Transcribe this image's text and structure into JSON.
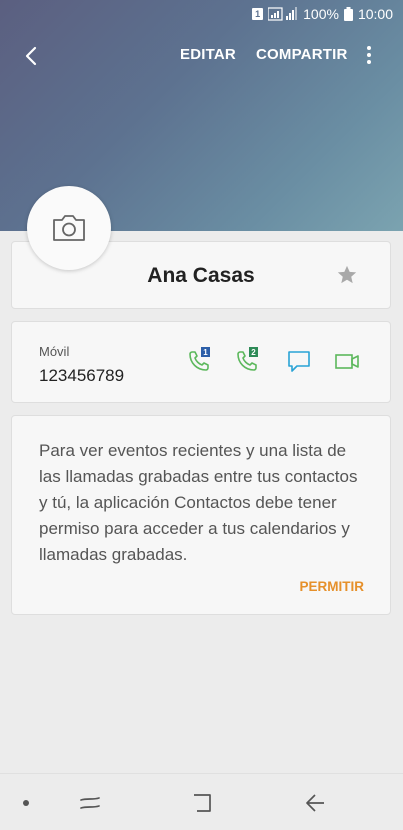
{
  "status_bar": {
    "sim_label": "1",
    "battery": "100%",
    "time": "10:00"
  },
  "toolbar": {
    "edit_label": "EDITAR",
    "share_label": "COMPARTIR"
  },
  "contact": {
    "name": "Ana Casas"
  },
  "phone": {
    "label": "Móvil",
    "number": "123456789",
    "sim1_badge": "1",
    "sim2_badge": "2"
  },
  "permission": {
    "message": "Para ver eventos recientes y una lista de las llamadas grabadas entre tus contactos y tú, la aplicación Contactos debe tener permiso para acceder a tus calendarios y llamadas grabadas.",
    "allow_label": "PERMITIR"
  },
  "colors": {
    "call_green": "#5cb85c",
    "message_blue": "#29a3d6",
    "video_green": "#5cb85c",
    "accent_orange": "#e6902a",
    "sim1_badge": "#2d5fa8",
    "sim2_badge": "#2e8b57"
  }
}
